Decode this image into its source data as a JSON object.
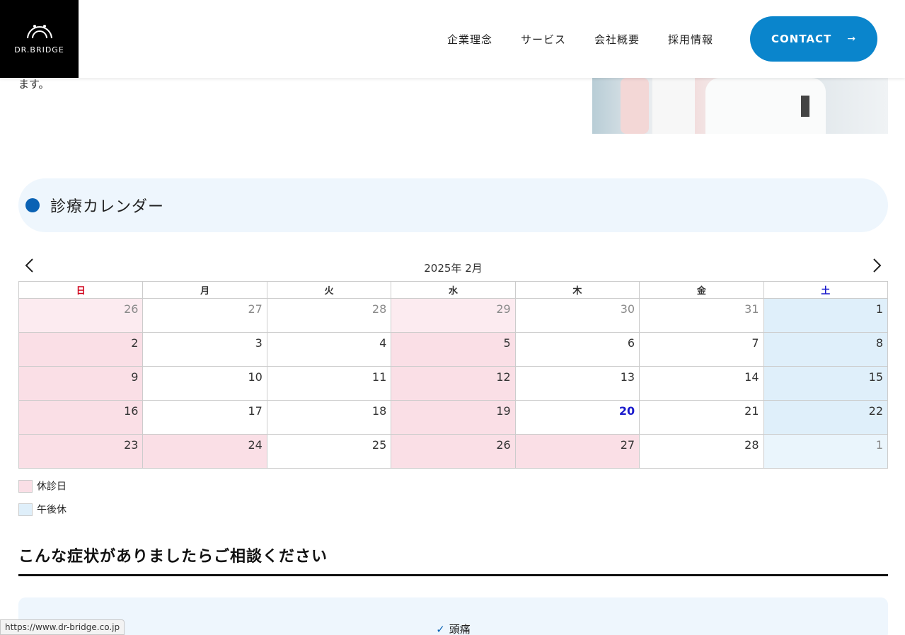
{
  "brand": {
    "logo_text": "DR.BRIDGE"
  },
  "nav": {
    "items": [
      "企業理念",
      "サービス",
      "会社概要",
      "採用情報"
    ],
    "contact_label": "CONTACT"
  },
  "intro_tail": "ます。",
  "section": {
    "title": "診療カレンダー"
  },
  "calendar": {
    "month_label": "2025年 2月",
    "weekdays": [
      "日",
      "月",
      "火",
      "水",
      "木",
      "金",
      "土"
    ],
    "weeks": [
      [
        {
          "d": "26",
          "type": "closed",
          "other": true
        },
        {
          "d": "27",
          "other": true
        },
        {
          "d": "28",
          "other": true
        },
        {
          "d": "29",
          "type": "closed",
          "other": true
        },
        {
          "d": "30",
          "other": true
        },
        {
          "d": "31",
          "other": true
        },
        {
          "d": "1",
          "type": "pm-off"
        }
      ],
      [
        {
          "d": "2",
          "type": "closed"
        },
        {
          "d": "3"
        },
        {
          "d": "4"
        },
        {
          "d": "5",
          "type": "closed"
        },
        {
          "d": "6"
        },
        {
          "d": "7"
        },
        {
          "d": "8",
          "type": "pm-off"
        }
      ],
      [
        {
          "d": "9",
          "type": "closed"
        },
        {
          "d": "10"
        },
        {
          "d": "11"
        },
        {
          "d": "12",
          "type": "closed"
        },
        {
          "d": "13"
        },
        {
          "d": "14"
        },
        {
          "d": "15",
          "type": "pm-off"
        }
      ],
      [
        {
          "d": "16",
          "type": "closed"
        },
        {
          "d": "17"
        },
        {
          "d": "18"
        },
        {
          "d": "19",
          "type": "closed"
        },
        {
          "d": "20",
          "today": true
        },
        {
          "d": "21"
        },
        {
          "d": "22",
          "type": "pm-off"
        }
      ],
      [
        {
          "d": "23",
          "type": "closed"
        },
        {
          "d": "24",
          "type": "closed"
        },
        {
          "d": "25"
        },
        {
          "d": "26",
          "type": "closed"
        },
        {
          "d": "27",
          "type": "closed"
        },
        {
          "d": "28"
        },
        {
          "d": "1",
          "type": "pm-off",
          "other": true
        }
      ]
    ]
  },
  "legend": {
    "closed_label": "休診日",
    "pm_off_label": "午後休",
    "closed_color": "#fadfe6",
    "pm_off_color": "#dfeffa"
  },
  "symptoms": {
    "heading": "こんな症状がありましたらご相談ください",
    "items": [
      "頭痛"
    ]
  },
  "status_bar": {
    "url": "https://www.dr-bridge.co.jp"
  },
  "colors": {
    "accent": "#0a85cc",
    "title_dot": "#0a62b4",
    "sunday": "#d0021b",
    "saturday": "#1a1acc"
  }
}
